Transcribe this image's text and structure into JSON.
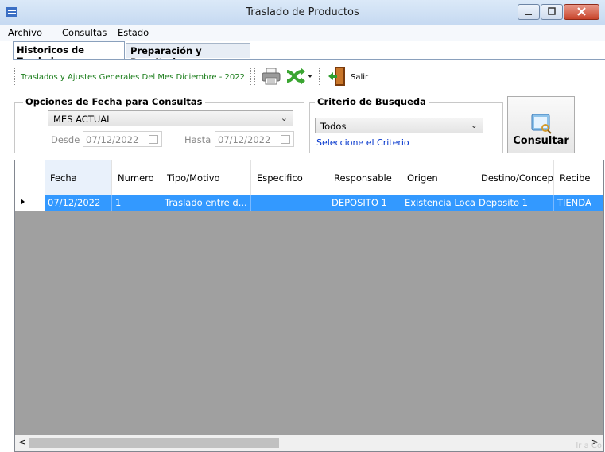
{
  "window": {
    "title": "Traslado de Productos"
  },
  "menu": [
    "Archivo",
    "Consultas",
    "Estado"
  ],
  "tabs": [
    {
      "label": "Historicos de Traslados",
      "active": true
    },
    {
      "label": "Preparación y Resultados",
      "active": false
    }
  ],
  "toolbar": {
    "label": "Traslados y Ajustes Generales  Del Mes Diciembre - 2022",
    "print_icon": "printer-icon",
    "shuffle_icon": "shuffle-icon",
    "exit_icon": "exit-door-icon",
    "exit_label": "Salir"
  },
  "date_options": {
    "title": "Opciones de Fecha para Consultas",
    "period": "MES ACTUAL",
    "from_label": "Desde",
    "from_value": "07/12/2022",
    "to_label": "Hasta",
    "to_value": "07/12/2022"
  },
  "criteria": {
    "title": "Criterio de Busqueda",
    "value": "Todos",
    "hint": "Seleccione el Criterio"
  },
  "consultar_button": "Consultar",
  "grid": {
    "columns": [
      "Fecha",
      "Numero",
      "Tipo/Motivo",
      "Especifico",
      "Responsable",
      "Origen",
      "Destino/Concep",
      "Recibe"
    ],
    "rows": [
      [
        "07/12/2022",
        "1",
        "Traslado entre d...",
        "",
        "DEPOSITO 1",
        "Existencia Local",
        "Deposito 1",
        "TIENDA"
      ]
    ]
  },
  "watermark": "Ir a Co",
  "colors": {
    "selection": "#3399ff",
    "toolbar_text": "#1b7d1b",
    "link": "#0033cc"
  }
}
